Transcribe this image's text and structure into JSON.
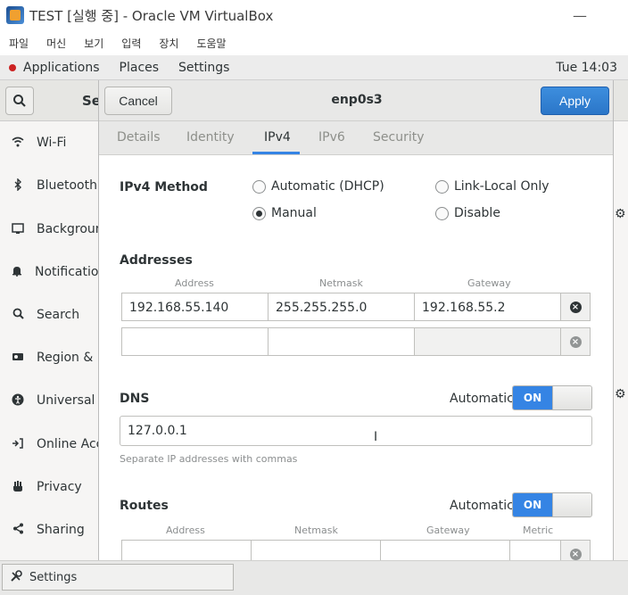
{
  "vbox": {
    "title": "TEST [실행 중] - Oracle VM VirtualBox",
    "minimize": "—",
    "menu": [
      "파일",
      "머신",
      "보기",
      "입력",
      "장치",
      "도움말"
    ]
  },
  "gnome": {
    "applications": "Applications",
    "places": "Places",
    "settings": "Settings",
    "clock": "Tue 14:03"
  },
  "sidebar": {
    "header_partial": "Se",
    "items": [
      {
        "label": "Wi-Fi",
        "icon": "wifi-icon"
      },
      {
        "label": "Bluetooth",
        "icon": "bluetooth-icon"
      },
      {
        "label": "Background",
        "icon": "background-icon"
      },
      {
        "label": "Notifications",
        "icon": "bell-icon"
      },
      {
        "label": "Search",
        "icon": "search-icon"
      },
      {
        "label": "Region & Language",
        "icon": "region-icon"
      },
      {
        "label": "Universal Access",
        "icon": "universal-access-icon"
      },
      {
        "label": "Online Accounts",
        "icon": "online-accounts-icon"
      },
      {
        "label": "Privacy",
        "icon": "privacy-icon"
      },
      {
        "label": "Sharing",
        "icon": "sharing-icon"
      }
    ]
  },
  "dialog": {
    "cancel": "Cancel",
    "title": "enp0s3",
    "apply": "Apply",
    "tabs": [
      "Details",
      "Identity",
      "IPv4",
      "IPv6",
      "Security"
    ],
    "active_tab": "IPv4",
    "ipv4_method_label": "IPv4 Method",
    "methods": {
      "dhcp": "Automatic (DHCP)",
      "link_local": "Link-Local Only",
      "manual": "Manual",
      "disable": "Disable",
      "selected": "Manual"
    },
    "addresses": {
      "label": "Addresses",
      "headers": [
        "Address",
        "Netmask",
        "Gateway"
      ],
      "rows": [
        {
          "address": "192.168.55.140",
          "netmask": "255.255.255.0",
          "gateway": "192.168.55.2"
        },
        {
          "address": "",
          "netmask": "",
          "gateway": ""
        }
      ]
    },
    "dns": {
      "label": "DNS",
      "automatic_label": "Automatic",
      "switch": "ON",
      "value": "127.0.0.1",
      "hint": "Separate IP addresses with commas"
    },
    "routes": {
      "label": "Routes",
      "automatic_label": "Automatic",
      "switch": "ON",
      "headers": [
        "Address",
        "Netmask",
        "Gateway",
        "Metric"
      ]
    }
  },
  "taskbar": {
    "item": "Settings"
  },
  "colors": {
    "accent": "#3584e4",
    "apply": "#2b76c8"
  }
}
